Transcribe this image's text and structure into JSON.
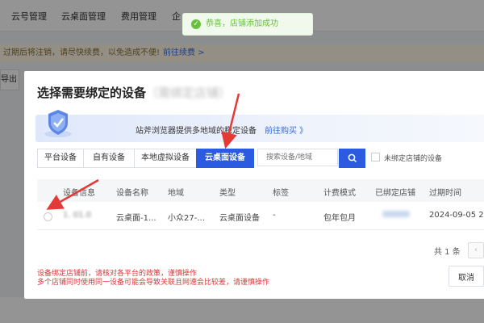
{
  "app": {
    "nav": [
      "云号管理",
      "云桌面管理",
      "费用管理",
      "企"
    ],
    "notice_text": "过期后将注销，请尽快续费，以免造成不便!",
    "notice_link": "前往续费 >",
    "left_button": "导出"
  },
  "toast": {
    "message": "恭喜，店铺添加成功"
  },
  "modal": {
    "title": "选择需要绑定的设备",
    "title_blurred": "（需绑定店铺）",
    "banner_text": "站斧浏览器提供多地域的稳定设备",
    "banner_link": "前往购买 》",
    "tabs": [
      "平台设备",
      "自有设备",
      "本地虚拟设备",
      "云桌面设备"
    ],
    "active_tab": "云桌面设备",
    "search_placeholder": "搜索设备/地域",
    "checkbox_label": "未绑定店铺的设备",
    "columns": [
      "设备信息",
      "设备名称",
      "地域",
      "类型",
      "标签",
      "计费模式",
      "已绑定店铺",
      "过期时间"
    ],
    "rows": [
      [
        "1.   01.0",
        "云桌面-1...",
        "小众27-...",
        "云桌面设备",
        "-",
        "包年包月",
        "",
        "2024-09-05 20"
      ]
    ],
    "pager_total": "共 1 条",
    "pager_prev": "‹",
    "warning_1": "设备绑定店铺前，请核对各平台的政策，谨慎操作",
    "warning_2": "多个店铺同时使用同一设备可能会导致关联且网速会比较差，请谨慎操作",
    "cancel_label": "取消"
  },
  "colors": {
    "primary": "#2a5be0",
    "warning": "#d63a3a",
    "success": "#67c23a",
    "annotation": "#e53935"
  }
}
